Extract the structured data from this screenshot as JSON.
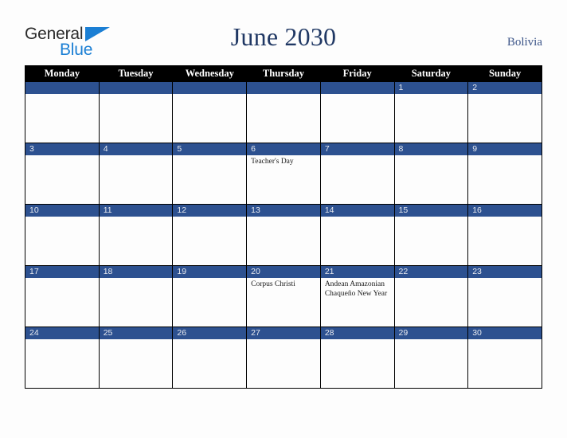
{
  "brand": {
    "line1": "General",
    "line2": "Blue",
    "triangle_icon": "triangle-icon",
    "color_dark": "#2b2b2b",
    "color_blue": "#1b7fd4"
  },
  "header": {
    "title": "June 2030",
    "country": "Bolivia",
    "title_color": "#203864",
    "country_color": "#3b5488"
  },
  "calendar": {
    "header_bg": "#000000",
    "header_text_color": "#ffffff",
    "daybar_bg": "#2d5190",
    "daybar_text_color": "#e8eaf0",
    "cell_bg": "#fdfdfd",
    "border_color": "#000000",
    "weekdays": [
      "Monday",
      "Tuesday",
      "Wednesday",
      "Thursday",
      "Friday",
      "Saturday",
      "Sunday"
    ],
    "weeks": [
      [
        {
          "day": "",
          "events": []
        },
        {
          "day": "",
          "events": []
        },
        {
          "day": "",
          "events": []
        },
        {
          "day": "",
          "events": []
        },
        {
          "day": "",
          "events": []
        },
        {
          "day": "1",
          "events": []
        },
        {
          "day": "2",
          "events": []
        }
      ],
      [
        {
          "day": "3",
          "events": []
        },
        {
          "day": "4",
          "events": []
        },
        {
          "day": "5",
          "events": []
        },
        {
          "day": "6",
          "events": [
            "Teacher's Day"
          ]
        },
        {
          "day": "7",
          "events": []
        },
        {
          "day": "8",
          "events": []
        },
        {
          "day": "9",
          "events": []
        }
      ],
      [
        {
          "day": "10",
          "events": []
        },
        {
          "day": "11",
          "events": []
        },
        {
          "day": "12",
          "events": []
        },
        {
          "day": "13",
          "events": []
        },
        {
          "day": "14",
          "events": []
        },
        {
          "day": "15",
          "events": []
        },
        {
          "day": "16",
          "events": []
        }
      ],
      [
        {
          "day": "17",
          "events": []
        },
        {
          "day": "18",
          "events": []
        },
        {
          "day": "19",
          "events": []
        },
        {
          "day": "20",
          "events": [
            "Corpus Christi"
          ]
        },
        {
          "day": "21",
          "events": [
            "Andean Amazonian Chaqueño New Year"
          ]
        },
        {
          "day": "22",
          "events": []
        },
        {
          "day": "23",
          "events": []
        }
      ],
      [
        {
          "day": "24",
          "events": []
        },
        {
          "day": "25",
          "events": []
        },
        {
          "day": "26",
          "events": []
        },
        {
          "day": "27",
          "events": []
        },
        {
          "day": "28",
          "events": []
        },
        {
          "day": "29",
          "events": []
        },
        {
          "day": "30",
          "events": []
        }
      ]
    ]
  }
}
